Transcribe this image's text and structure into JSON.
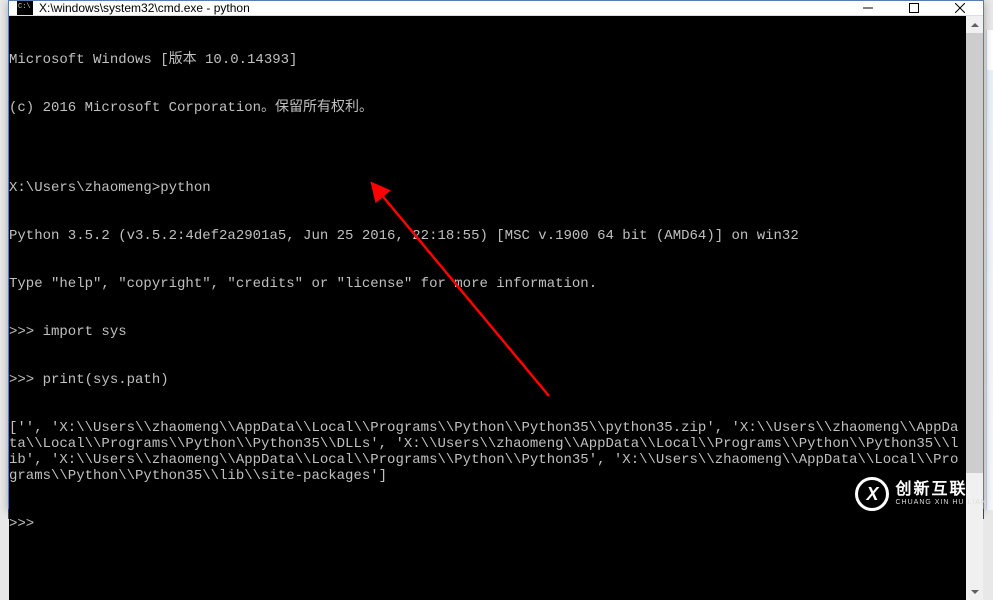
{
  "window": {
    "title": "X:\\windows\\system32\\cmd.exe - python"
  },
  "terminal": {
    "lines": [
      "Microsoft Windows [版本 10.0.14393]",
      "(c) 2016 Microsoft Corporation。保留所有权利。",
      "",
      "X:\\Users\\zhaomeng>python",
      "Python 3.5.2 (v3.5.2:4def2a2901a5, Jun 25 2016, 22:18:55) [MSC v.1900 64 bit (AMD64)] on win32",
      "Type \"help\", \"copyright\", \"credits\" or \"license\" for more information.",
      ">>> import sys",
      ">>> print(sys.path)",
      "['', 'X:\\\\Users\\\\zhaomeng\\\\AppData\\\\Local\\\\Programs\\\\Python\\\\Python35\\\\python35.zip', 'X:\\\\Users\\\\zhaomeng\\\\AppData\\\\Local\\\\Programs\\\\Python\\\\Python35\\\\DLLs', 'X:\\\\Users\\\\zhaomeng\\\\AppData\\\\Local\\\\Programs\\\\Python\\\\Python35\\\\lib', 'X:\\\\Users\\\\zhaomeng\\\\AppData\\\\Local\\\\Programs\\\\Python\\\\Python35', 'X:\\\\Users\\\\zhaomeng\\\\AppData\\\\Local\\\\Programs\\\\Python\\\\Python35\\\\lib\\\\site-packages']",
      ">>> "
    ]
  },
  "annotation": {
    "arrow_color": "#ff0000"
  },
  "watermark": {
    "logo_text": "X",
    "text_cn": "创新互联",
    "text_en": "CHUANG XIN HU LIAN"
  }
}
